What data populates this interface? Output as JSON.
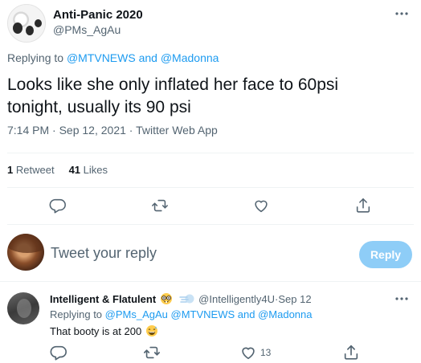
{
  "main_tweet": {
    "display_name": "Anti-Panic 2020",
    "handle": "@PMs_AgAu",
    "reply_prefix": "Replying to ",
    "reply_to_1": "@MTVNEWS",
    "reply_and": " and ",
    "reply_to_2": "@Madonna",
    "text": "Looks like she only inflated her face to 60psi tonight, usually its 90 psi",
    "time": "7:14 PM",
    "date": "Sep 12, 2021",
    "source": "Twitter Web App",
    "separator": " · ",
    "retweets_count": "1",
    "retweets_label": "Retweet",
    "likes_count": "41",
    "likes_label": "Likes",
    "actions": [
      "reply-icon",
      "retweet-icon",
      "like-icon",
      "share-icon"
    ]
  },
  "composer": {
    "placeholder": "Tweet your reply",
    "button_label": "Reply"
  },
  "reply_tweet": {
    "display_name": "Intelligent & Flatulent",
    "handle": "@Intelligently4U",
    "date": "Sep 12",
    "separator": " · ",
    "reply_prefix": "Replying to ",
    "reply_to_1": "@PMs_AgAu",
    "reply_to_2": "@MTVNEWS",
    "reply_and": " and ",
    "reply_to_3": "@Madonna",
    "text": "That booty is at 200",
    "like_count": "13",
    "emojis": [
      "nerd-face-emoji",
      "dash-emoji",
      "grinning-sweat-emoji"
    ]
  },
  "colors": {
    "accent": "#1d9bf0",
    "secondary_text": "#536471",
    "primary_text": "#0f1419",
    "disabled_button": "#8ecdf7"
  }
}
